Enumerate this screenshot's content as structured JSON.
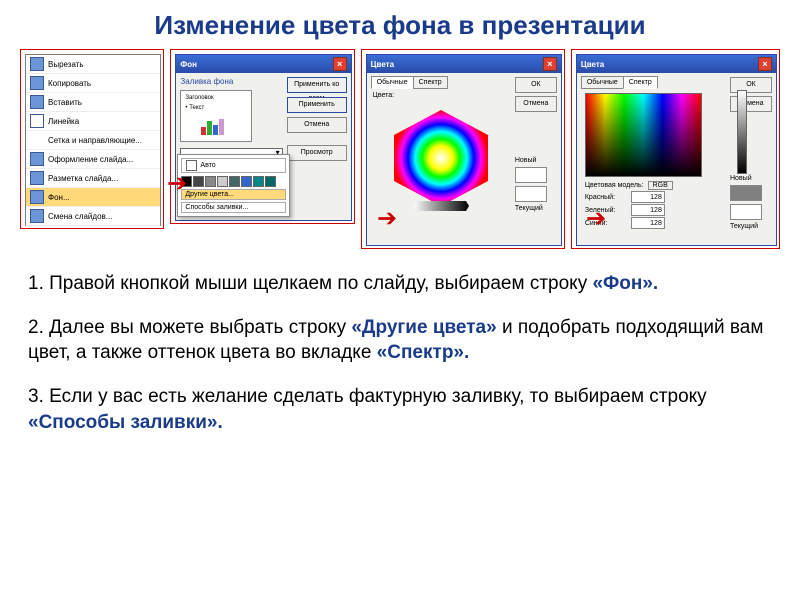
{
  "title": "Изменение цвета фона в презентации",
  "panel1": {
    "items": [
      {
        "label": "Вырезать"
      },
      {
        "label": "Копировать"
      },
      {
        "label": "Вставить"
      },
      {
        "label": "Линейка"
      },
      {
        "label": "Сетка и направляющие..."
      },
      {
        "label": "Оформление слайда..."
      },
      {
        "label": "Разметка слайда..."
      },
      {
        "label": "Фон..."
      },
      {
        "label": "Смена слайдов..."
      }
    ]
  },
  "panel2": {
    "title": "Фон",
    "section": "Заливка фона",
    "preview_title": "Заголовок",
    "preview_text": "• Текст",
    "auto": "Авто",
    "more": "Другие цвета...",
    "fillways": "Способы заливки...",
    "btn_apply_all": "Применить ко всем",
    "btn_apply": "Применить",
    "btn_cancel": "Отмена",
    "btn_preview": "Просмотр"
  },
  "panel3": {
    "title": "Цвета",
    "tab1": "Обычные",
    "tab2": "Спектр",
    "colors_label": "Цвета:",
    "ok": "ОК",
    "cancel": "Отмена",
    "new": "Новый",
    "cur": "Текущий"
  },
  "panel4": {
    "title": "Цвета",
    "tab1": "Обычные",
    "tab2": "Спектр",
    "ok": "ОК",
    "cancel": "Отмена",
    "model_label": "Цветовая модель:",
    "model_value": "RGB",
    "r_label": "Красный:",
    "g_label": "Зеленый:",
    "b_label": "Синий:",
    "r": "128",
    "g": "128",
    "b": "128",
    "new": "Новый",
    "cur": "Текущий"
  },
  "instructions": {
    "p1a": "1. Правой кнопкой мыши щелкаем по слайду, выбираем строку ",
    "p1k": "«Фон».",
    "p2a": "2. Далее вы можете выбрать строку ",
    "p2k1": "«Другие цвета»",
    "p2b": " и подобрать подходящий вам цвет, а также оттенок цвета во вкладке ",
    "p2k2": "«Спектр».",
    "p3a": "3. Если у вас есть желание сделать фактурную заливку, то выбираем строку ",
    "p3k": "«Способы заливки»."
  }
}
